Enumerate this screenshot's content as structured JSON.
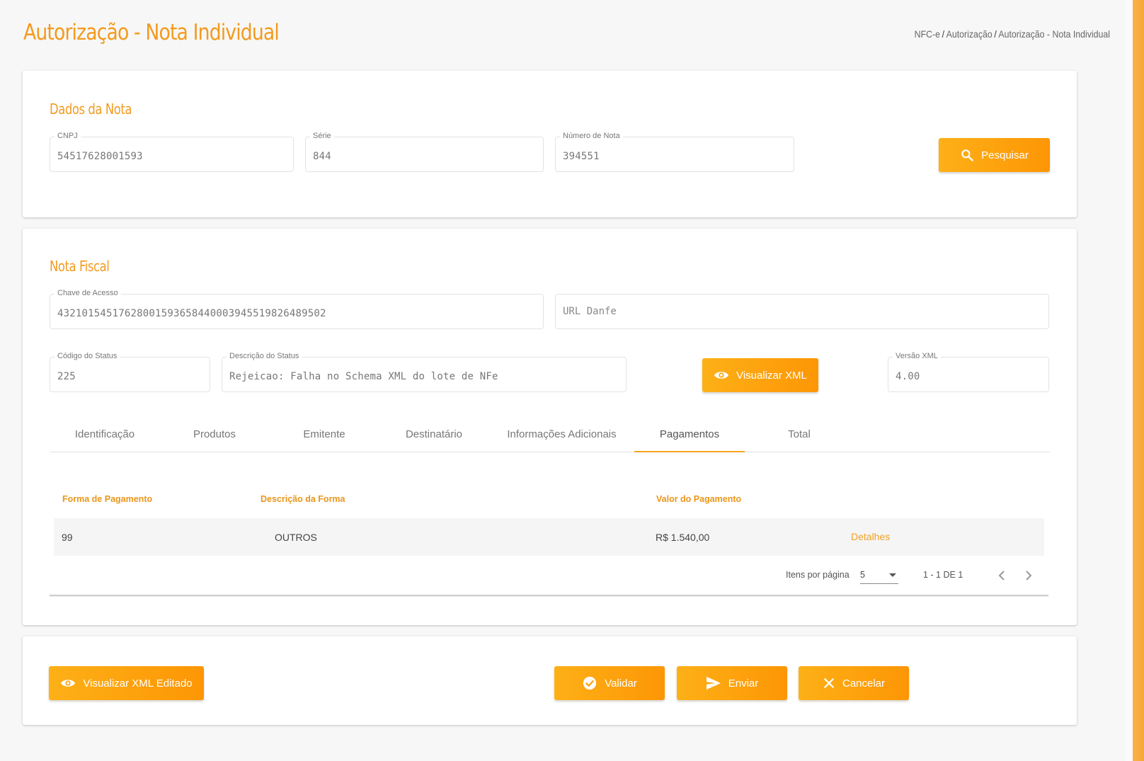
{
  "header": {
    "title": "Autorização - Nota Individual",
    "breadcrumb": [
      "NFC-e",
      "Autorização",
      "Autorização - Nota Individual"
    ]
  },
  "dados_nota": {
    "title": "Dados da Nota",
    "cnpj": {
      "label": "CNPJ",
      "value": "54517628001593"
    },
    "serie": {
      "label": "Série",
      "value": "844"
    },
    "numero": {
      "label": "Número de Nota",
      "value": "394551"
    },
    "search_button": "Pesquisar"
  },
  "nota_fiscal": {
    "title": "Nota Fiscal",
    "chave": {
      "label": "Chave de Acesso",
      "value": "43210154517628001593658440003945519826489502"
    },
    "url_danfe": {
      "placeholder": "URL Danfe"
    },
    "codigo_status": {
      "label": "Código do Status",
      "value": "225"
    },
    "descricao_status": {
      "label": "Descrição do Status",
      "value": "Rejeicao: Falha no Schema XML do lote de NFe"
    },
    "visualizar_xml_button": "Visualizar XML",
    "versao_xml": {
      "label": "Versão XML",
      "value": "4.00"
    }
  },
  "tabs": [
    "Identificação",
    "Produtos",
    "Emitente",
    "Destinatário",
    "Informações Adicionais",
    "Pagamentos",
    "Total"
  ],
  "active_tab": "Pagamentos",
  "pagamentos_table": {
    "columns": [
      "Forma de Pagamento",
      "Descrição da Forma",
      "Valor do Pagamento"
    ],
    "rows": [
      {
        "forma": "99",
        "descricao": "OUTROS",
        "valor": "R$ 1.540,00",
        "action": "Detalhes"
      }
    ],
    "paginator": {
      "items_label": "Itens por página",
      "page_size": "5",
      "range": "1 - 1 DE 1"
    }
  },
  "actions": {
    "visualizar_xml_editado": "Visualizar XML Editado",
    "validar": "Validar",
    "enviar": "Enviar",
    "cancelar": "Cancelar"
  },
  "colors": {
    "accent": "#f39a1e",
    "button_start": "#fdb017",
    "button_end": "#fd9605"
  }
}
